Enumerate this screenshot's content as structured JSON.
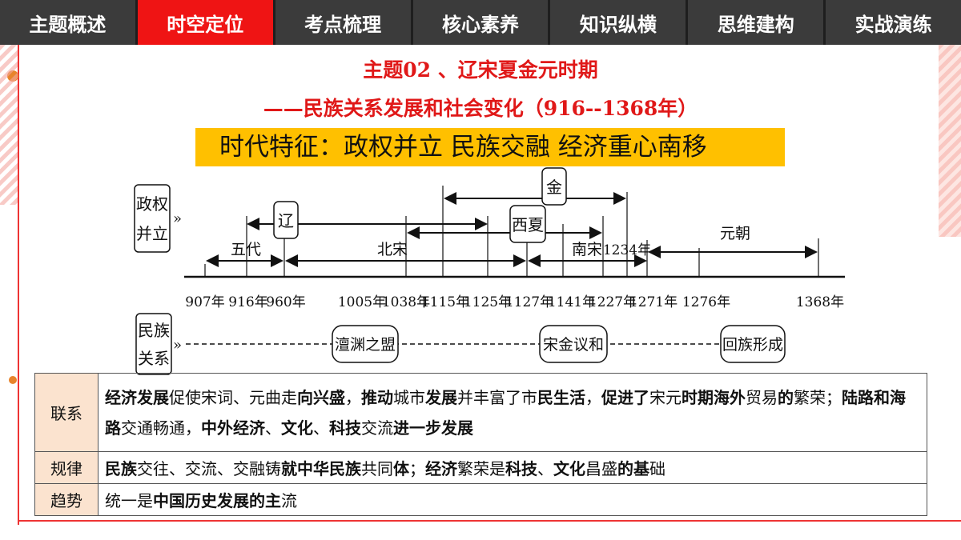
{
  "nav": {
    "tabs": [
      {
        "label": "主题概述",
        "active": false
      },
      {
        "label": "时空定位",
        "active": true
      },
      {
        "label": "考点梳理",
        "active": false
      },
      {
        "label": "核心素养",
        "active": false
      },
      {
        "label": "知识纵横",
        "active": false
      },
      {
        "label": "思维建构",
        "active": false
      },
      {
        "label": "实战演练",
        "active": false
      }
    ]
  },
  "title": {
    "line1": "主题02 、辽宋夏金元时期",
    "line2": "——民族关系发展和社会变化（916--1368年）"
  },
  "feature": "时代特征：政权并立  民族交融  经济重心南移",
  "diagram": {
    "row1_label": "政权并立",
    "row2_label": "民族关系",
    "arrow_mark": "»",
    "regimes": [
      "辽",
      "金",
      "西夏"
    ],
    "periods": [
      "五代",
      "北宋",
      "南宋",
      "元朝"
    ],
    "boundary_label": "1234年",
    "years": [
      "907年",
      "916年",
      "960年",
      "1005年",
      "1038年",
      "1115年",
      "1125年",
      "1127年",
      "1141年",
      "1227年",
      "1271年",
      "1276年",
      "1368年"
    ],
    "events": [
      "澶渊之盟",
      "宋金议和",
      "回族形成"
    ]
  },
  "table": {
    "rows": [
      {
        "label": "联系",
        "parts": [
          [
            "b",
            "经济发展"
          ],
          [
            "n",
            "促使宋词、元曲走"
          ],
          [
            "b",
            "向兴盛"
          ],
          [
            "n",
            "，"
          ],
          [
            "b",
            "推动"
          ],
          [
            "n",
            "城市"
          ],
          [
            "b",
            "发展"
          ],
          [
            "n",
            "并丰富了市"
          ],
          [
            "b",
            "民生活"
          ],
          [
            "n",
            "，"
          ],
          [
            "b",
            "促进了"
          ],
          [
            "n",
            "宋元"
          ],
          [
            "b",
            "时期海外"
          ],
          [
            "n",
            "贸易"
          ],
          [
            "b",
            "的"
          ],
          [
            "n",
            "繁荣；"
          ],
          [
            "b",
            "陆路和海路"
          ],
          [
            "n",
            "交通畅通，"
          ],
          [
            "b",
            "中外经济"
          ],
          [
            "n",
            "、"
          ],
          [
            "b",
            "文化"
          ],
          [
            "n",
            "、"
          ],
          [
            "b",
            "科技"
          ],
          [
            "n",
            "交流"
          ],
          [
            "b",
            "进一步发展"
          ]
        ]
      },
      {
        "label": "规律",
        "parts": [
          [
            "b",
            "民族"
          ],
          [
            "n",
            "交往、交流、交融铸"
          ],
          [
            "b",
            "就中华民族"
          ],
          [
            "n",
            "共同"
          ],
          [
            "b",
            "体"
          ],
          [
            "n",
            "；"
          ],
          [
            "b",
            "经济"
          ],
          [
            "n",
            "繁荣是"
          ],
          [
            "b",
            "科技"
          ],
          [
            "n",
            "、"
          ],
          [
            "b",
            "文化"
          ],
          [
            "n",
            "昌盛"
          ],
          [
            "b",
            "的基"
          ],
          [
            "n",
            "础"
          ]
        ]
      },
      {
        "label": "趋势",
        "parts": [
          [
            "n",
            "统一是"
          ],
          [
            "b",
            "中国历史发展的主"
          ],
          [
            "n",
            "流"
          ]
        ]
      }
    ]
  }
}
